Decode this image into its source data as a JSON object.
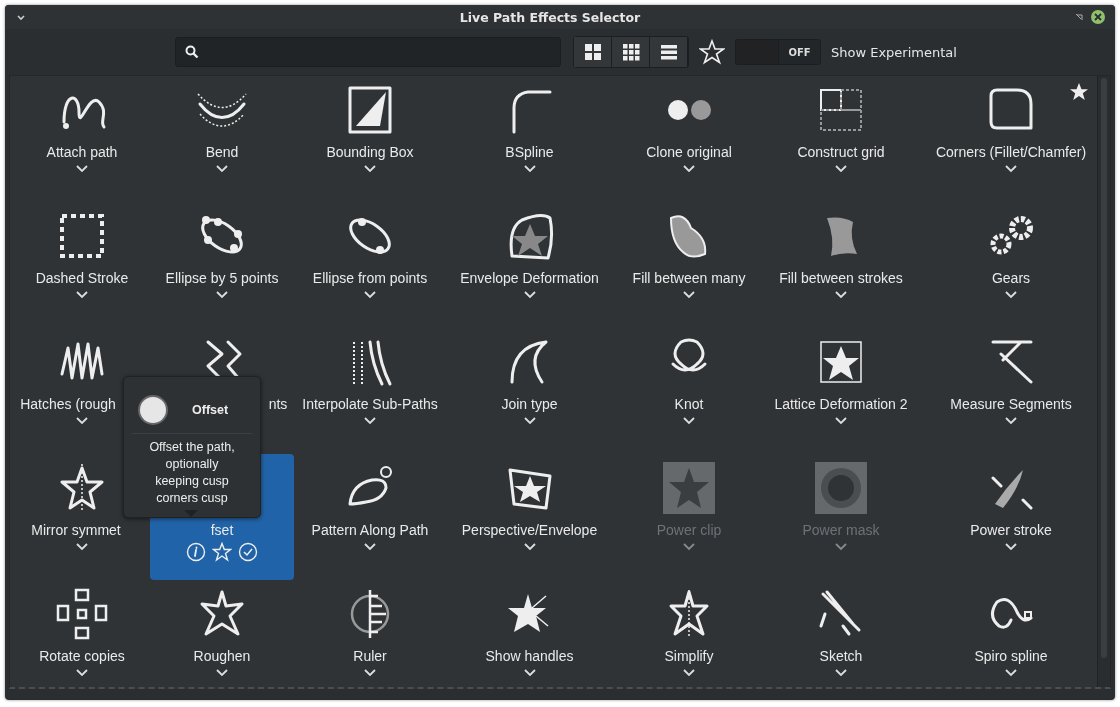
{
  "window": {
    "title": "Live Path Effects Selector"
  },
  "toolbar": {
    "views": [
      {
        "kind": "large"
      },
      {
        "kind": "small"
      },
      {
        "kind": "list"
      }
    ],
    "favorites_only": false,
    "experimental": {
      "on": false,
      "state_label": "OFF",
      "label": "Show Experimental"
    }
  },
  "effects": [
    {
      "label": "Attach path",
      "favorite": false,
      "disabled": false,
      "selected": false
    },
    {
      "label": "Bend",
      "favorite": false,
      "disabled": false,
      "selected": false
    },
    {
      "label": "Bounding Box",
      "favorite": false,
      "disabled": false,
      "selected": false
    },
    {
      "label": "BSpline",
      "favorite": false,
      "disabled": false,
      "selected": false
    },
    {
      "label": "Clone original",
      "favorite": false,
      "disabled": false,
      "selected": false
    },
    {
      "label": "Construct grid",
      "favorite": false,
      "disabled": false,
      "selected": false
    },
    {
      "label": "Corners (Fillet/Chamfer)",
      "favorite": true,
      "disabled": false,
      "selected": false
    },
    {
      "label": "Dashed Stroke",
      "favorite": false,
      "disabled": false,
      "selected": false
    },
    {
      "label": "Ellipse by 5 points",
      "favorite": false,
      "disabled": false,
      "selected": false
    },
    {
      "label": "Ellipse from points",
      "favorite": false,
      "disabled": false,
      "selected": false
    },
    {
      "label": "Envelope Deformation",
      "favorite": false,
      "disabled": false,
      "selected": false
    },
    {
      "label": "Fill between many",
      "favorite": false,
      "disabled": false,
      "selected": false
    },
    {
      "label": "Fill between strokes",
      "favorite": false,
      "disabled": false,
      "selected": false
    },
    {
      "label": "Gears",
      "favorite": false,
      "disabled": false,
      "selected": false
    },
    {
      "label": "Hatches (rough",
      "favorite": false,
      "disabled": false,
      "selected": false
    },
    {
      "label": "nts",
      "favorite": false,
      "disabled": false,
      "selected": false
    },
    {
      "label": "Interpolate Sub-Paths",
      "favorite": false,
      "disabled": false,
      "selected": false
    },
    {
      "label": "Join type",
      "favorite": false,
      "disabled": false,
      "selected": false
    },
    {
      "label": "Knot",
      "favorite": false,
      "disabled": false,
      "selected": false
    },
    {
      "label": "Lattice Deformation 2",
      "favorite": false,
      "disabled": false,
      "selected": false
    },
    {
      "label": "Measure Segments",
      "favorite": false,
      "disabled": false,
      "selected": false
    },
    {
      "label": "Mirror symmet",
      "favorite": false,
      "disabled": false,
      "selected": false
    },
    {
      "label": "fset",
      "favorite": false,
      "disabled": false,
      "selected": true
    },
    {
      "label": "Pattern Along Path",
      "favorite": false,
      "disabled": false,
      "selected": false
    },
    {
      "label": "Perspective/Envelope",
      "favorite": false,
      "disabled": false,
      "selected": false
    },
    {
      "label": "Power clip",
      "favorite": false,
      "disabled": true,
      "selected": false
    },
    {
      "label": "Power mask",
      "favorite": false,
      "disabled": true,
      "selected": false
    },
    {
      "label": "Power stroke",
      "favorite": false,
      "disabled": false,
      "selected": false
    },
    {
      "label": "Rotate copies",
      "favorite": false,
      "disabled": false,
      "selected": false
    },
    {
      "label": "Roughen",
      "favorite": false,
      "disabled": false,
      "selected": false
    },
    {
      "label": "Ruler",
      "favorite": false,
      "disabled": false,
      "selected": false
    },
    {
      "label": "Show handles",
      "favorite": false,
      "disabled": false,
      "selected": false
    },
    {
      "label": "Simplify",
      "favorite": false,
      "disabled": false,
      "selected": false
    },
    {
      "label": "Sketch",
      "favorite": false,
      "disabled": false,
      "selected": false
    },
    {
      "label": "Spiro spline",
      "favorite": false,
      "disabled": false,
      "selected": false
    }
  ],
  "tooltip": {
    "title": "Offset",
    "description": "Offset the path, optionally keeping cusp corners cusp"
  }
}
